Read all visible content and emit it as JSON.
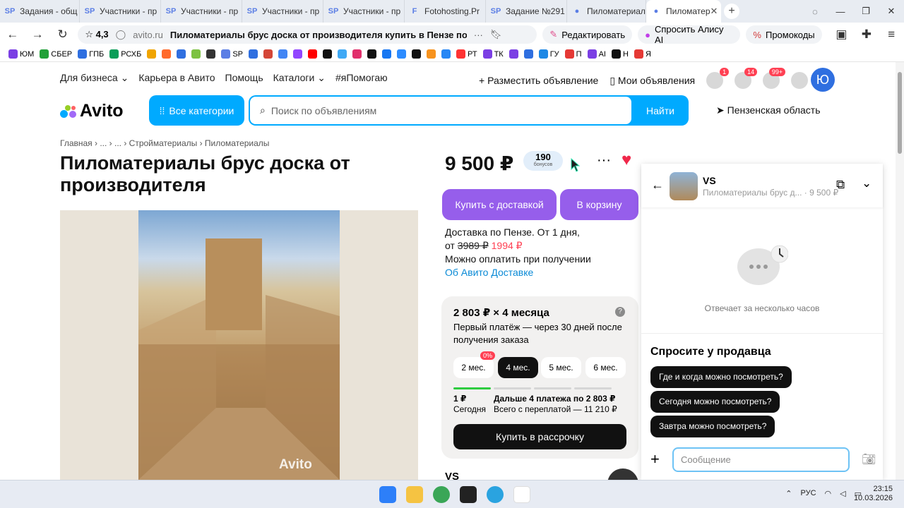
{
  "browser": {
    "tabs": [
      {
        "label": "Задания - общ",
        "fav": "SP"
      },
      {
        "label": "Участники - пр",
        "fav": "SP"
      },
      {
        "label": "Участники - пр",
        "fav": "SP"
      },
      {
        "label": "Участники - пр",
        "fav": "SP"
      },
      {
        "label": "Участники - пр",
        "fav": "SP"
      },
      {
        "label": "Fotohosting.Pr",
        "fav": "F"
      },
      {
        "label": "Задание №291",
        "fav": "SP"
      },
      {
        "label": "Пиломатериал",
        "fav": "●"
      },
      {
        "label": "Пиломатер",
        "fav": "●"
      }
    ],
    "rating": "4,3",
    "domain": "avito.ru",
    "page_title": "Пиломатериалы брус доска от производителя купить в Пензе по низк...",
    "edit_label": "Редактировать",
    "alice_label": "Спросить Алису AI",
    "promo_label": "Промокоды",
    "bookmarks": [
      "ЮМ",
      "СБЕР",
      "ГПБ",
      "РСХБ",
      "",
      "",
      "",
      "",
      "",
      "SP",
      "",
      "",
      "",
      "",
      "",
      "",
      "",
      "",
      "",
      "",
      "",
      "",
      "",
      "",
      "РТ",
      "ТК",
      "",
      "",
      "ГУ",
      "П",
      "AI",
      "Н",
      "Я"
    ]
  },
  "nav": {
    "links": [
      "Для бизнеса",
      "Карьера в Авито",
      "Помощь",
      "Каталоги",
      "#яПомогаю"
    ],
    "post_ad": "Разместить объявление",
    "my_ads": "Мои объявления",
    "fav_count": "1",
    "notif_count": "14",
    "msg_count": "99+",
    "avatar_letter": "Ю"
  },
  "header": {
    "logo": "Avito",
    "all_categories": "Все категории",
    "search_placeholder": "Поиск по объявлениям",
    "search_button": "Найти",
    "region": "Пензенская область"
  },
  "breadcrumbs": "Главная › ... › ... › Стройматериалы › Пиломатериалы",
  "listing": {
    "title": "Пиломатериалы брус доска от производителя",
    "watermark": "Avito",
    "price": "9 500 ₽",
    "bonus_value": "190",
    "bonus_label": "бонусов",
    "buy_delivery": "Купить с доставкой",
    "to_cart": "В корзину",
    "delivery_line1": "Доставка по Пензе. От 1 дня,",
    "delivery_from": "от",
    "delivery_old": "3989 ₽",
    "delivery_new": "1994 ₽",
    "pay_on_receive": "Можно оплатить при получении",
    "about_delivery": "Об Авито Доставке",
    "seller": "VS"
  },
  "installment": {
    "headline": "2 803 ₽ × 4 месяца",
    "desc": "Первый платёж — через 30 дней после получения заказа",
    "months": [
      "2 мес.",
      "4 мес.",
      "5 мес.",
      "6 мес."
    ],
    "selected_index": 1,
    "zero_badge": "0%",
    "first_amount": "1 ₽",
    "first_when": "Сегодня",
    "next_label": "Дальше 4 платежа по 2 803 ₽",
    "total_label": "Всего с переплатой — 11 210 ₽",
    "button": "Купить в рассрочку",
    "progress_filled_segments": 1
  },
  "chat": {
    "seller_name": "VS",
    "item_line": "Пиломатериалы брус д... · 9 500 ₽",
    "reply_time": "Отвечает за несколько часов",
    "ask_title": "Спросите у продавца",
    "quick_questions": [
      "Где и когда можно посмотреть?",
      "Сегодня можно посмотреть?",
      "Завтра можно посмотреть?"
    ],
    "message_placeholder": "Сообщение"
  },
  "taskbar": {
    "lang": "РУС",
    "time": "23:15",
    "date": "10.03.2026"
  },
  "colors": {
    "avito_blue": "#00aaff",
    "purple": "#965eeb",
    "red": "#ff4053",
    "link": "#0a8ad6"
  }
}
